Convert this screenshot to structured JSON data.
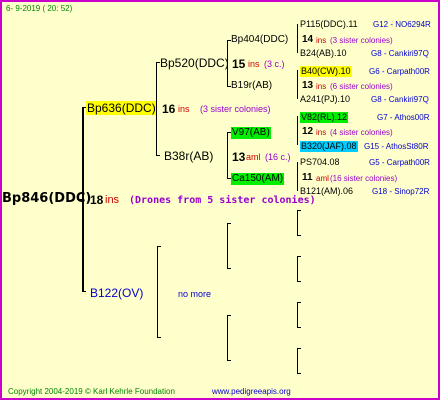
{
  "header": {
    "date": "6-  9-2019 ( 20: 52)"
  },
  "root": {
    "label": "Bp846(DDC)",
    "count": "18",
    "unit": "ins",
    "note": "(Drones from 5 sister colonies)"
  },
  "gen1": {
    "upper": {
      "label": "Bp636(DDC)",
      "count": "16",
      "unit": "ins",
      "note": "(3 sister colonies)"
    },
    "lower": {
      "label": "B122(OV)",
      "note": "no more"
    }
  },
  "gen2": {
    "upper": {
      "label": "Bp520(DDC)",
      "count": "15",
      "unit": "ins",
      "note": "(3 c.)"
    },
    "lower": {
      "label": "B38r(AB)",
      "count": "13",
      "unit": "aml",
      "note": "(16 c.)"
    }
  },
  "gen3": {
    "a": {
      "label": "Bp404(DDC)",
      "count": "14",
      "unit": "ins",
      "note": "(3 sister colonies)"
    },
    "b": {
      "label": "B19r(AB)",
      "count": "13",
      "unit": "ins",
      "note": "(6 sister colonies)"
    },
    "c": {
      "label": "V97(AB)",
      "count": "12",
      "unit": "ins",
      "note": "(4 sister colonies)"
    },
    "d": {
      "label": "Ca150(AM)",
      "count": "11",
      "unit": "aml",
      "note": "(16 sister colonies)"
    }
  },
  "gen4": [
    {
      "label": "P115(DDC).11",
      "group": "G12 - NO6294R"
    },
    {
      "label": "B24(AB).10",
      "group": "G8 - Cankiri97Q"
    },
    {
      "label": "B40(CW).10",
      "group": "G6 - Carpath00R"
    },
    {
      "label": "A241(PJ).10",
      "group": "G8 - Cankiri97Q"
    },
    {
      "label": "V82(RL).12",
      "group": "G7 - Athos00R"
    },
    {
      "label": "B320(JAF).08",
      "group": "G15 - AthosSt80R"
    },
    {
      "label": "PS704.08",
      "group": "G5 - Carpath00R"
    },
    {
      "label": "B121(AM).06",
      "group": "G18 - Sinop72R"
    }
  ],
  "footer": {
    "copyright": "Copyright 2004-2019 © Karl Kehrle Foundation",
    "url": "www.pedigreeapis.org"
  },
  "colors": {
    "border": "#cc00cc",
    "background": "#ffffcc",
    "highlight_yellow": "#ffff00",
    "highlight_green": "#00ee00",
    "highlight_cyan": "#00ccff"
  }
}
